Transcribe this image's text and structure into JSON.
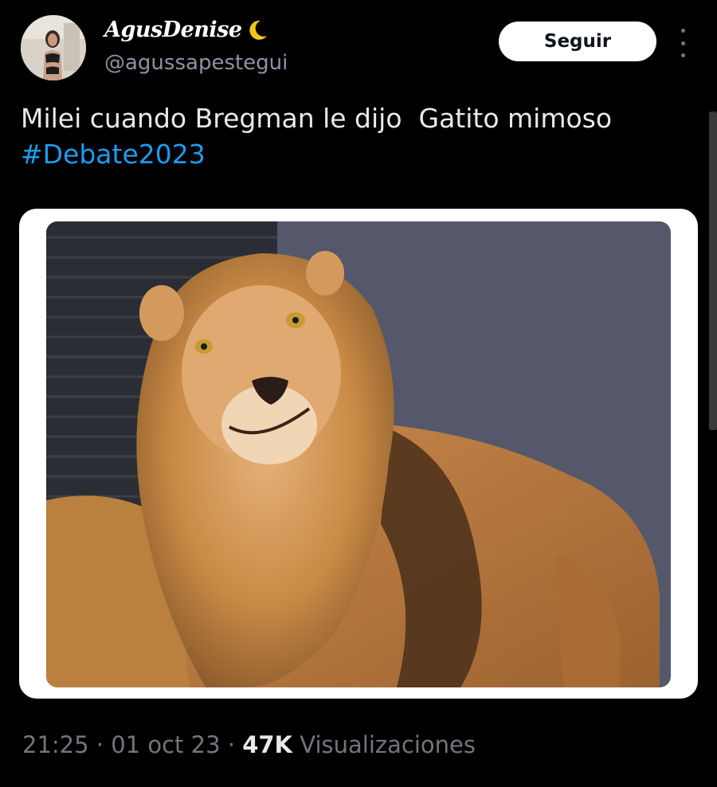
{
  "author": {
    "display_name": "AgusDenise",
    "handle": "@agussapestegui",
    "name_emoji": "crescent-moon-icon",
    "avatar": "avatar-photo"
  },
  "actions": {
    "follow_label": "Seguir",
    "more": "more-options-icon"
  },
  "tweet": {
    "text_line1": "Milei cuando Bregman le dijo  Gatito mimoso",
    "hashtag": "#Debate2023"
  },
  "media": {
    "subject": "lion-photo"
  },
  "meta": {
    "time": "21:25",
    "separator": "·",
    "date": "01 oct 23",
    "views_count": "47K",
    "views_label": "Visualizaciones"
  },
  "colors": {
    "background": "#000000",
    "text": "#e7e9ea",
    "secondary": "#71767b",
    "link": "#1d9bf0",
    "button_bg": "#ffffff"
  }
}
